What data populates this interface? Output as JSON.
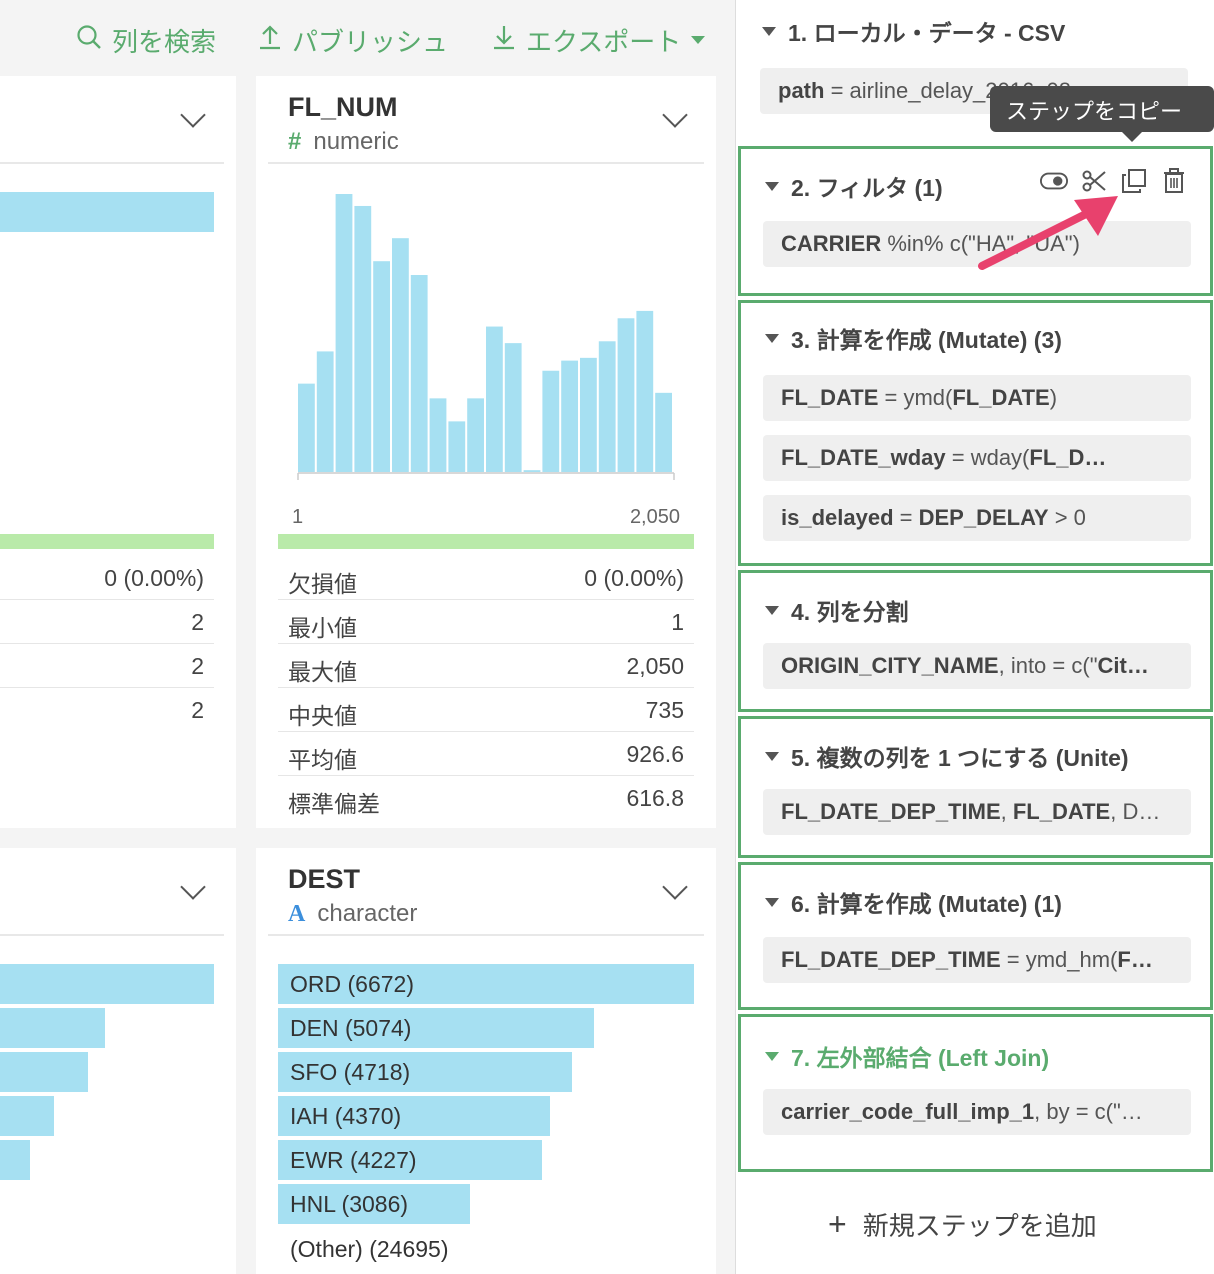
{
  "toolbar": {
    "search_label": "列を検索",
    "publish_label": "パブリッシュ",
    "export_label": "エクスポート"
  },
  "left_card_top": {
    "missing_value": "0 (0.00%)",
    "stats_values": [
      "2",
      "2",
      "2"
    ]
  },
  "fl_num_card": {
    "name": "FL_NUM",
    "type_glyph": "#",
    "type": "numeric",
    "hist_min_label": "1",
    "hist_max_label": "2,050",
    "stats": [
      {
        "label": "欠損値",
        "value": "0 (0.00%)"
      },
      {
        "label": "最小値",
        "value": "1"
      },
      {
        "label": "最大値",
        "value": "2,050"
      },
      {
        "label": "中央値",
        "value": "735"
      },
      {
        "label": "平均値",
        "value": "926.6"
      },
      {
        "label": "標準偏差",
        "value": "616.8"
      }
    ]
  },
  "chart_data": {
    "type": "bar",
    "title": "",
    "xlabel": "",
    "ylabel": "",
    "x_range": [
      1,
      2050
    ],
    "bar_color": "#a6e0f2",
    "values": [
      96,
      131,
      302,
      289,
      229,
      254,
      214,
      80,
      55,
      80,
      158,
      140,
      2,
      110,
      121,
      124,
      142,
      167,
      175,
      86
    ]
  },
  "dest_card": {
    "name": "DEST",
    "type_glyph": "A",
    "type": "character",
    "bars": [
      {
        "label": "ORD (6672)",
        "count": 6672
      },
      {
        "label": "DEN (5074)",
        "count": 5074
      },
      {
        "label": "SFO (4718)",
        "count": 4718
      },
      {
        "label": "IAH (4370)",
        "count": 4370
      },
      {
        "label": "EWR (4227)",
        "count": 4227
      },
      {
        "label": "HNL (3086)",
        "count": 3086
      }
    ],
    "other_label": "(Other) (24695)"
  },
  "left_card_bottom": {
    "bar_fractions": [
      1.0,
      0.49,
      0.41,
      0.25,
      0.14
    ]
  },
  "steps": [
    {
      "title": "1. ローカル・データ - CSV",
      "pills": [
        {
          "key": "path",
          "rest": " = airline_delay_2016_08.csv"
        }
      ]
    },
    {
      "title": "2. フィルタ (1)",
      "pills": [
        {
          "key": "CARRIER",
          "rest": " %in% c(\"HA\", \"UA\")"
        }
      ]
    },
    {
      "title": "3. 計算を作成 (Mutate) (3)",
      "pills": [
        {
          "key": "FL_DATE",
          "rest": " = ymd(",
          "key2": "FL_DATE",
          "rest2": ")"
        },
        {
          "key": "FL_DATE_wday",
          "rest": " = wday(",
          "key2": "FL_D…",
          "rest2": ""
        },
        {
          "key": "is_delayed",
          "rest": " = ",
          "key2": "DEP_DELAY",
          "rest2": " > 0"
        }
      ]
    },
    {
      "title": "4. 列を分割",
      "pills": [
        {
          "key": "ORIGIN_CITY_NAME",
          "rest": ", into = c(\"",
          "key2": "Cit…",
          "rest2": ""
        }
      ]
    },
    {
      "title": "5. 複数の列を 1 つにする (Unite)",
      "pills": [
        {
          "key": "FL_DATE_DEP_TIME",
          "rest": ", ",
          "key2": "FL_DATE",
          "rest2": ", D…"
        }
      ]
    },
    {
      "title": "6. 計算を作成 (Mutate) (1)",
      "pills": [
        {
          "key": "FL_DATE_DEP_TIME",
          "rest": " = ymd_hm(",
          "key2": "F…",
          "rest2": ""
        }
      ]
    },
    {
      "title": "7. 左外部結合 (Left Join)",
      "pills": [
        {
          "key": "carrier_code_full_imp_1",
          "rest": ", by = c(\"…"
        }
      ]
    }
  ],
  "tooltip": "ステップをコピー",
  "add_step_label": "新規ステップを追加",
  "colors": {
    "accent_green": "#5aab6e",
    "bar_blue": "#a6e0f2",
    "bar_green": "#b9eaa9",
    "arrow_pink": "#e8416d"
  }
}
